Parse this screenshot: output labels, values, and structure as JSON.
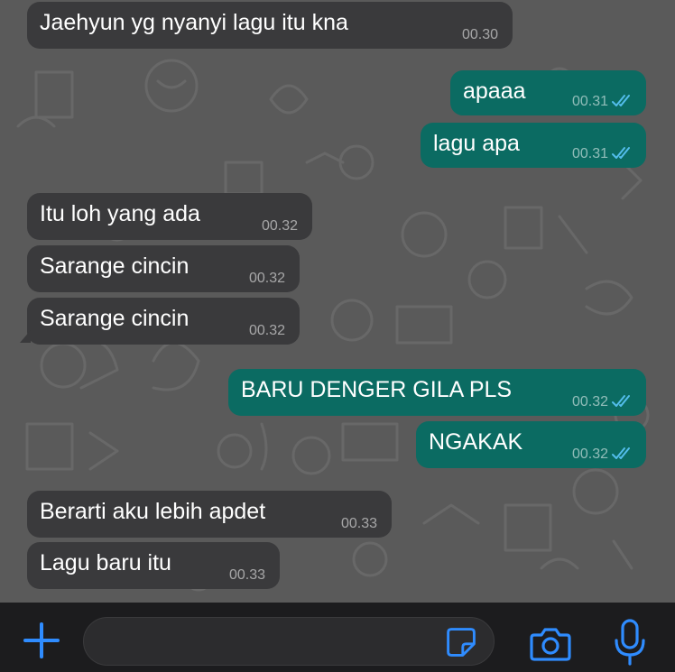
{
  "messages": [
    {
      "direction": "in",
      "text": "Jaehyun yg nyanyi lagu itu kna",
      "time": "00.30"
    },
    {
      "direction": "out",
      "text": "apaaa",
      "time": "00.31",
      "read": true
    },
    {
      "direction": "out",
      "text": "lagu apa",
      "time": "00.31",
      "read": true
    },
    {
      "direction": "in",
      "text": "Itu loh yang ada",
      "time": "00.32"
    },
    {
      "direction": "in",
      "text": "Sarange cincin",
      "time": "00.32"
    },
    {
      "direction": "in",
      "text": "Sarange cincin",
      "time": "00.32"
    },
    {
      "direction": "out",
      "text": "BARU DENGER GILA PLS",
      "time": "00.32",
      "read": true
    },
    {
      "direction": "out",
      "text": "NGAKAK",
      "time": "00.32",
      "read": true
    },
    {
      "direction": "in",
      "text": "Berarti aku lebih apdet",
      "time": "00.33"
    },
    {
      "direction": "in",
      "text": "Lagu baru itu",
      "time": "00.33"
    }
  ],
  "input_bar": {
    "add_icon": "plus-icon",
    "sticker_icon": "sticker-icon",
    "camera_icon": "camera-icon",
    "mic_icon": "microphone-icon",
    "placeholder": ""
  },
  "colors": {
    "incoming_bubble": "#3a3a3c",
    "outgoing_bubble": "#0b6b62",
    "accent": "#2f8cff",
    "read_ticks": "#53bdeb"
  }
}
